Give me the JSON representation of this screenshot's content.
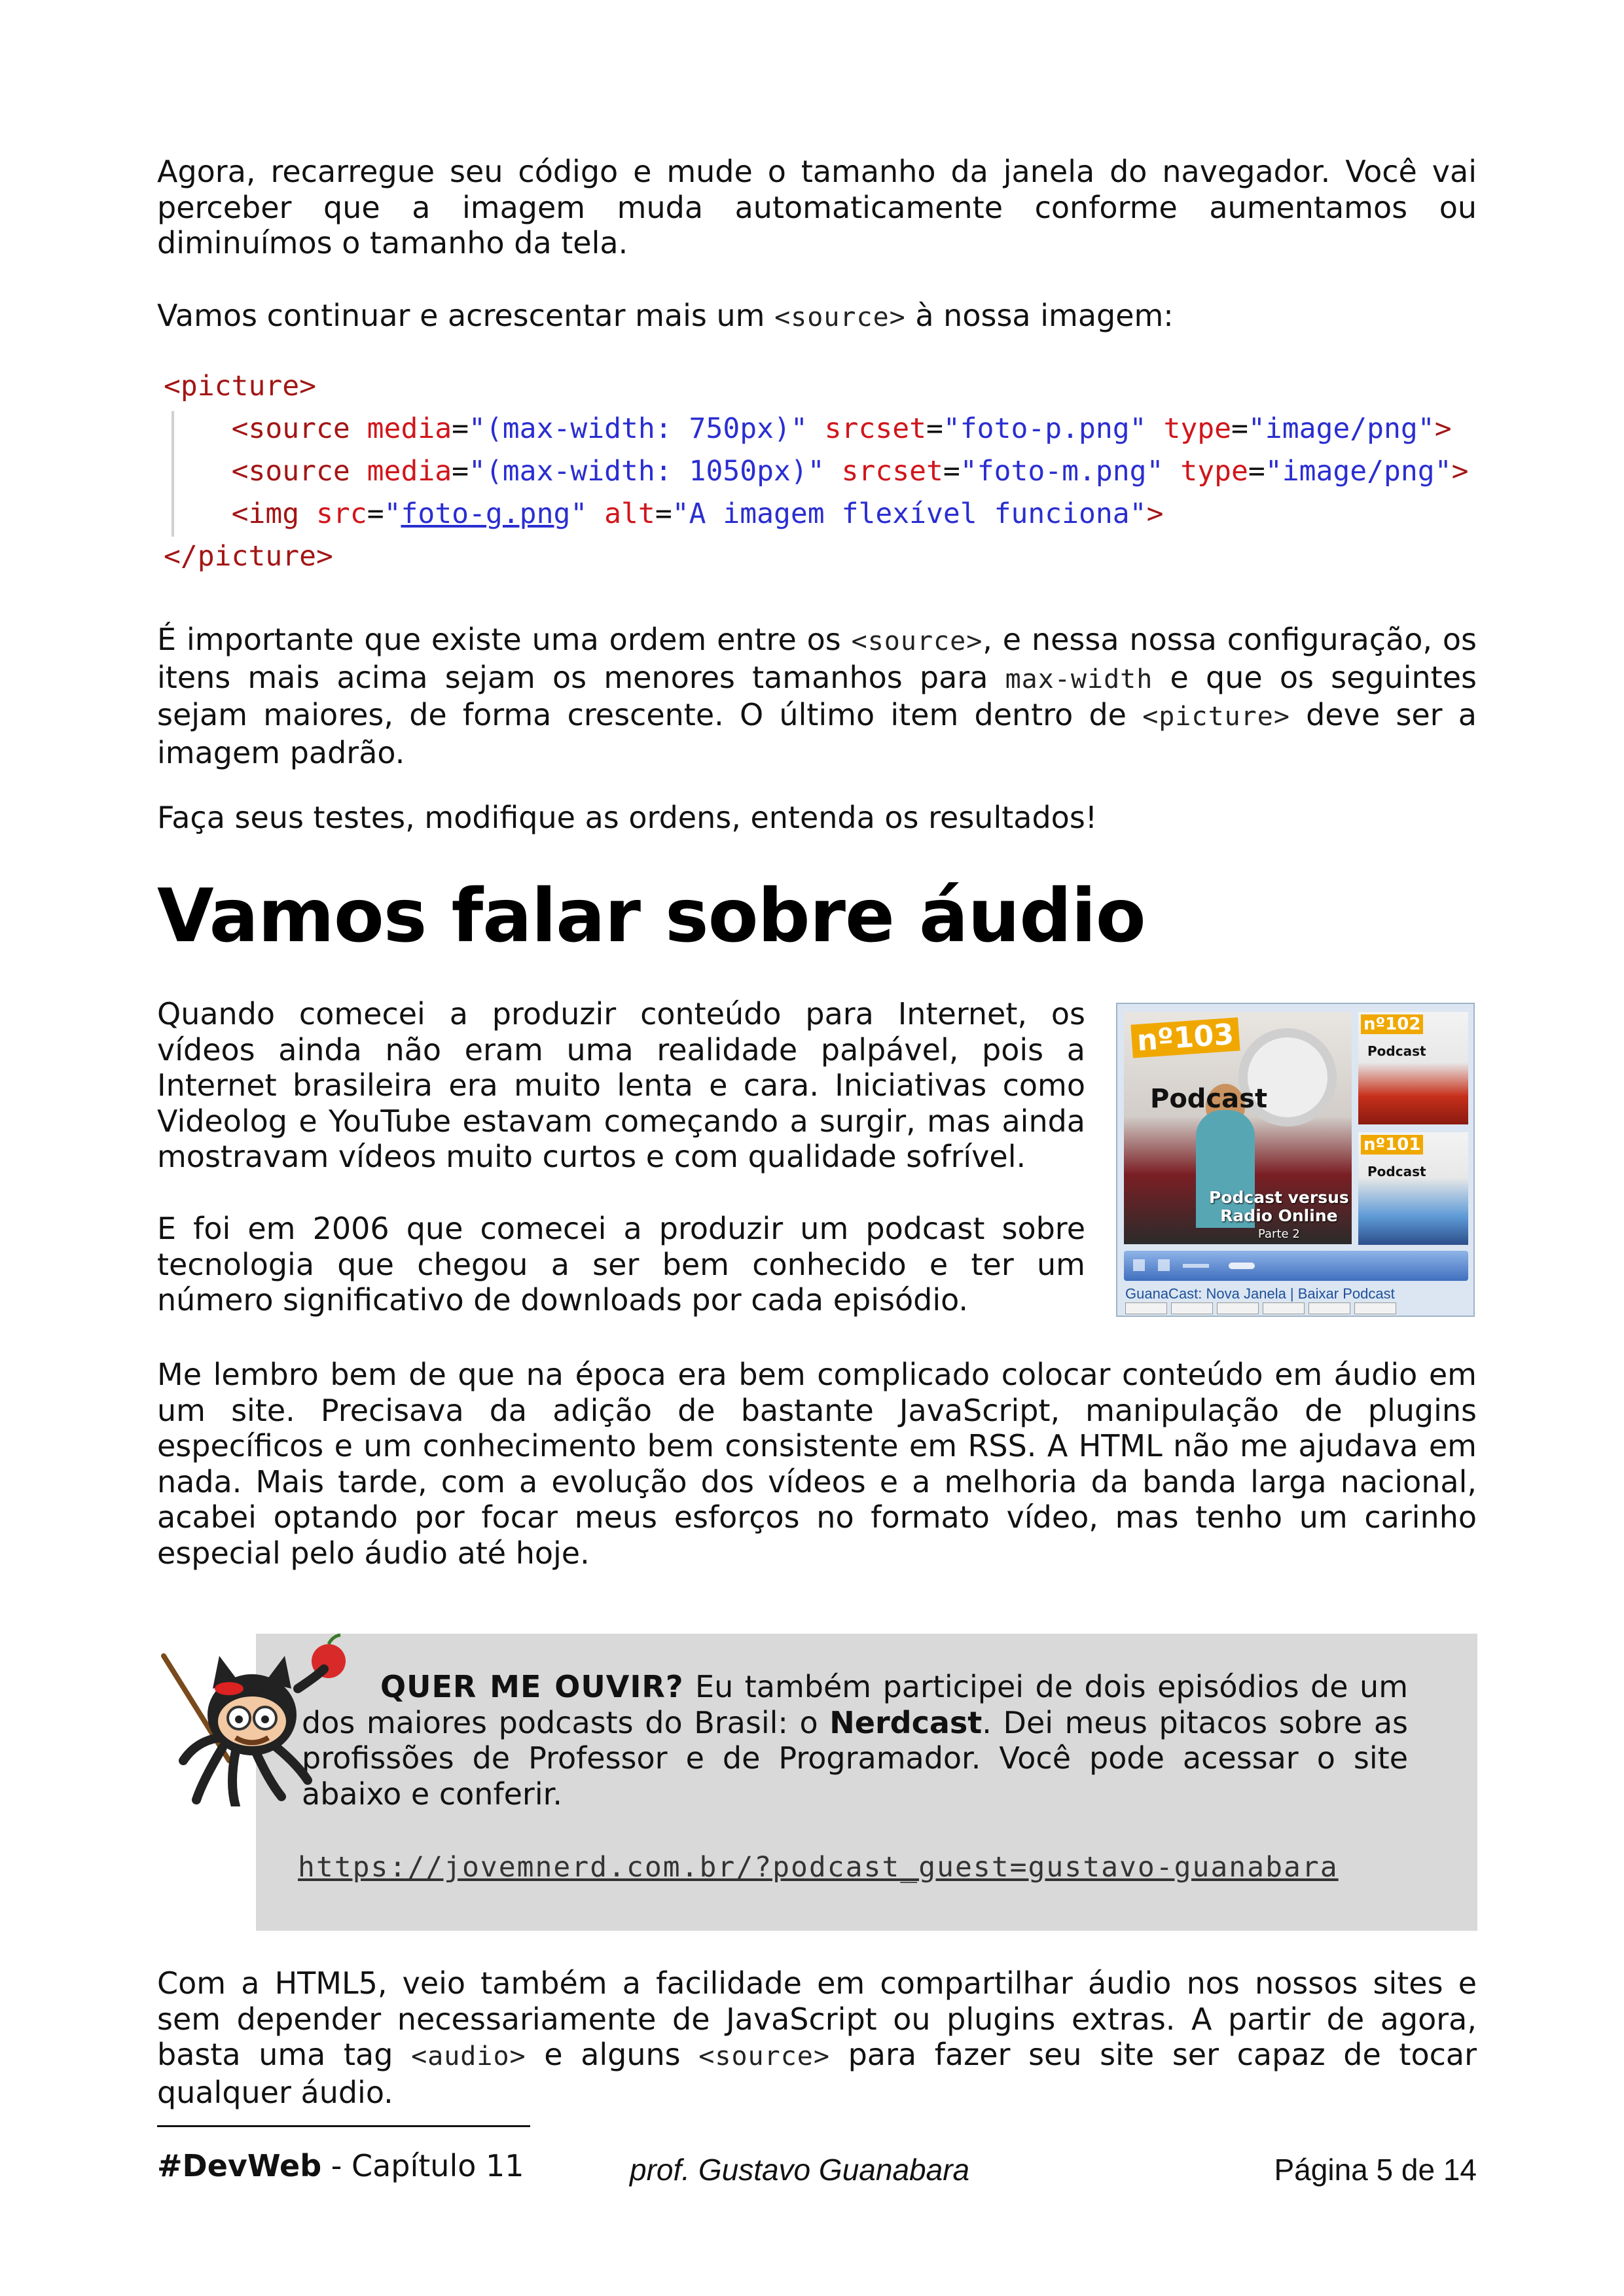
{
  "body": {
    "p1": "Agora, recarregue seu código e mude o tamanho da janela do navegador. Você vai perceber que a imagem muda automaticamente conforme aumentamos ou diminuímos o tamanho da tela.",
    "p2_before": "Vamos continuar e acrescentar mais um ",
    "p2_code": "<source>",
    "p2_after": " à nossa imagem:",
    "p3_a": "É importante que existe uma ordem entre os ",
    "p3_code1": "<source>",
    "p3_b": ", e nessa nossa configuração, os itens mais acima sejam os menores tamanhos para ",
    "p3_code2": "max-width",
    "p3_c": " e que os seguintes sejam maiores, de forma crescente.  O último item dentro de ",
    "p3_code3": "<picture>",
    "p3_d": " deve ser a imagem padrão.",
    "p4": "Faça seus testes, modifique as ordens, entenda os resultados!",
    "section_title": "Vamos falar sobre áudio",
    "p5": "Quando comecei a produzir conteúdo para Internet, os vídeos ainda não eram uma realidade palpável, pois a Internet brasileira era muito lenta e cara. Iniciativas como Videolog e YouTube estavam começando a surgir, mas ainda mostravam vídeos muito curtos e com qualidade sofrível.",
    "p6": "E foi em 2006 que comecei a produzir um podcast sobre tecnologia que chegou a ser bem conhecido e ter um número significativo de downloads por cada episódio.",
    "p7": "Me lembro bem de que na época era bem complicado colocar conteúdo em áudio em um site. Precisava da adição de bastante JavaScript, manipulação de plugins específicos e um conhecimento bem consistente em RSS. A HTML não me ajudava em nada. Mais tarde, com a evolução dos vídeos e a melhoria da banda larga nacional, acabei optando por focar meus esforços no formato vídeo, mas tenho um carinho especial pelo áudio até hoje.",
    "p8_a": "Com a HTML5, veio também a facilidade em compartilhar áudio nos nossos sites e sem depender necessariamente de JavaScript ou plugins extras. A partir de agora, basta uma tag ",
    "p8_code1": "<audio>",
    "p8_b": " e alguns ",
    "p8_code2": "<source>",
    "p8_c": " para fazer seu site ser capaz de tocar qualquer áudio."
  },
  "code": {
    "open_tag": "<picture>",
    "line1_tag": "<source",
    "line1_attr1": "media",
    "line1_val1": "\"(max-width: 750px)\"",
    "line1_attr2": "srcset",
    "line1_val2": "\"foto-p.png\"",
    "line1_attr3": "type",
    "line1_val3": "\"image/png\"",
    "line1_end": ">",
    "line2_tag": "<source",
    "line2_attr1": "media",
    "line2_val1": "\"(max-width: 1050px)\"",
    "line2_attr2": "srcset",
    "line2_val2": "\"foto-m.png\"",
    "line2_attr3": "type",
    "line2_val3": "\"image/png\"",
    "line2_end": ">",
    "line3_tag": "<img",
    "line3_attr1": "src",
    "line3_val1_q": "\"",
    "line3_val1": "foto-g.png",
    "line3_attr2": "alt",
    "line3_val2": "\"A imagem flexível funciona\"",
    "line3_end": ">",
    "close_tag": "</picture>",
    "eq": "="
  },
  "podcast_image": {
    "badge_main": "nº103",
    "word_main": "Podcast",
    "caption_1": "Podcast versus",
    "caption_2": "Radio Online",
    "caption_3": "Parte 2",
    "badge_side1": "nº102",
    "badge_side2": "nº101",
    "word_side": "Podcast",
    "links": "GuanaCast: Nova Janela | Baixar Podcast"
  },
  "callout": {
    "lead": "QUER ME OUVIR?",
    "text_a": " Eu também participei de dois episódios de um dos maiores podcasts do Brasil: o ",
    "bold": "Nerdcast",
    "text_b": ". Dei meus pitacos sobre as profissões de Professor e de Programador. Você pode acessar o site abaixo e conferir.",
    "url": "https://jovemnerd.com.br/?podcast_guest=gustavo-guanabara"
  },
  "footer": {
    "brand": "#DevWeb",
    "chapter": " - Capítulo 11",
    "author": "prof. Gustavo Guanabara",
    "page": "Página 5 de 14"
  },
  "colors": {
    "callout_bg": "#d9d9d9",
    "code_tag": "#a31515",
    "code_string": "#2a2ed0"
  }
}
